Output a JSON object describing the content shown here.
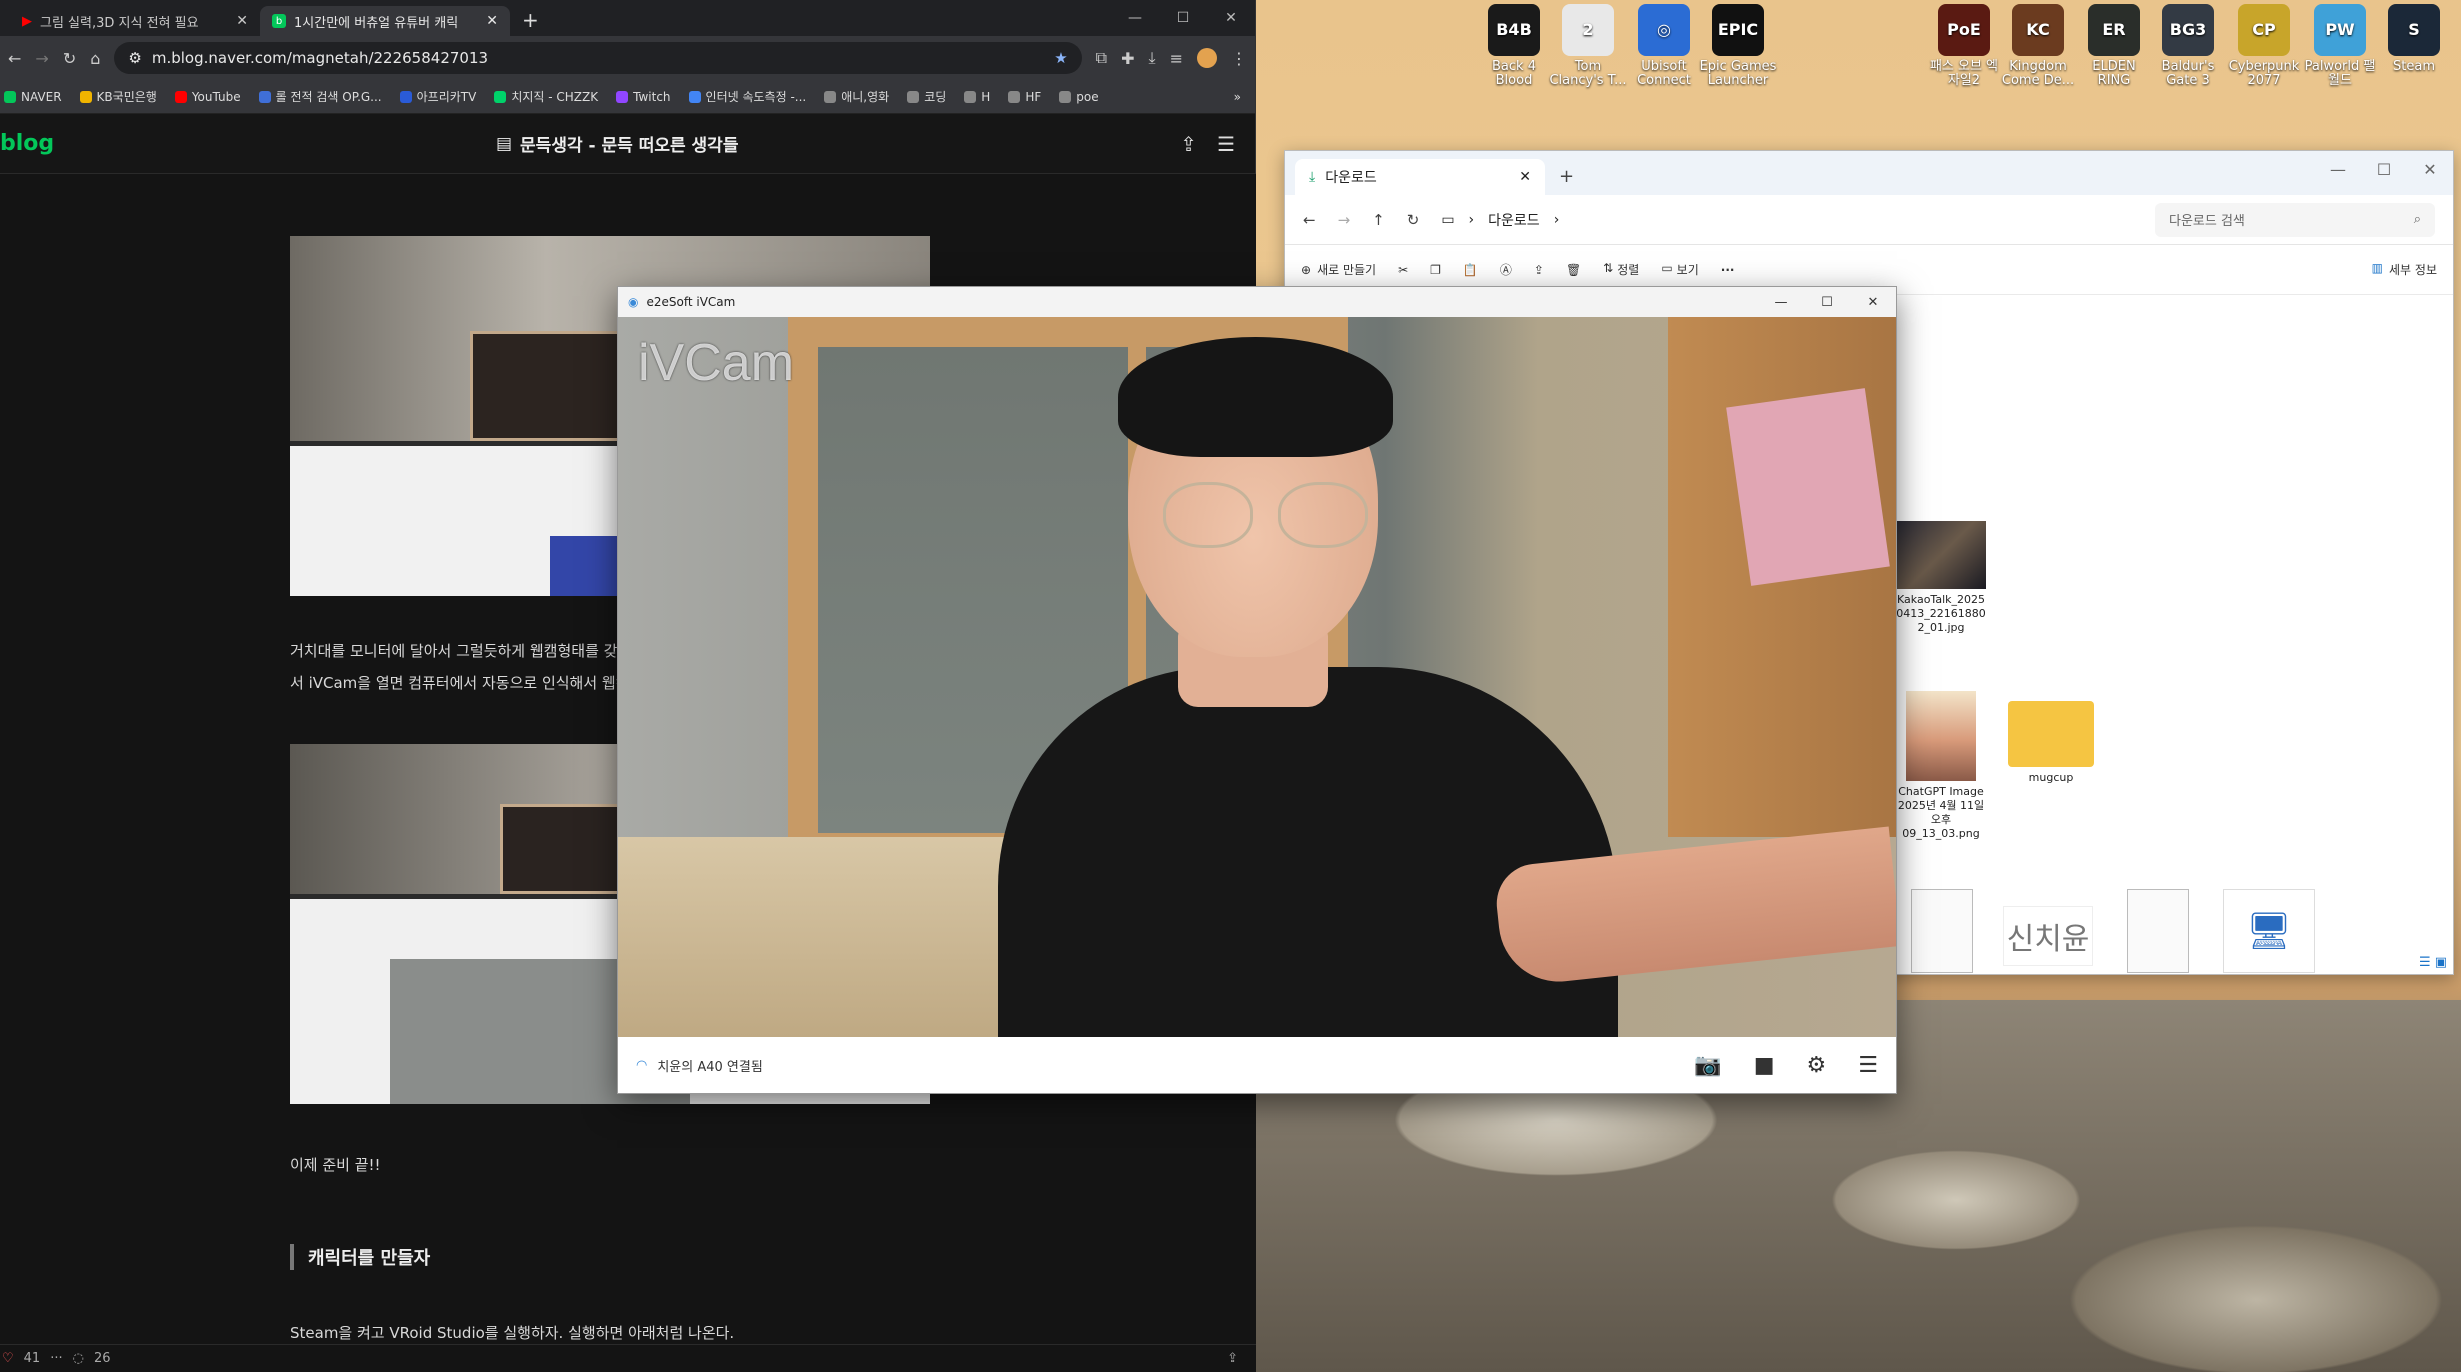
{
  "browser": {
    "tabs": [
      {
        "label": "그림 실력,3D 지식 전혀 필요",
        "close": "✕"
      },
      {
        "label": "1시간만에 버츄얼 유튜버 캐릭",
        "close": "✕"
      }
    ],
    "new_tab": "+",
    "url": "m.blog.naver.com/magnetah/222658427013",
    "bookmarks": [
      "NAVER",
      "KB국민은행",
      "YouTube",
      "롤 전적 검색 OP.G...",
      "아프리카TV",
      "치지직 - CHZZK",
      "Twitch",
      "인터넷 속도측정 -...",
      "애니,영화",
      "코딩",
      "H",
      "HF",
      "poe"
    ],
    "more": "»",
    "blog_logo": "blog",
    "blog_title": "문득생각 - 문득 떠오른 생각들",
    "paragraph1_line1": "거치대를 모니터에 달아서 그럴듯하게 웹캠형태를 갖춰",
    "paragraph1_line2": "서  iVCam을 열면 컴퓨터에서 자동으로 인식해서 웹캠",
    "ready_text": "이제 준비 끝!!",
    "section_heading": "캐릭터를 만들자",
    "steam_text": "Steam을 켜고 VRoid Studio를 실행하자. 실행하면 아래처럼 나온다.",
    "like_count": "41",
    "comment_count": "26",
    "dots": "···"
  },
  "desktop_icons": [
    {
      "label": "Back 4 Blood",
      "glyph": "B4B",
      "color": "#1a1a1a"
    },
    {
      "label": "Tom Clancy's T...",
      "glyph": "2",
      "color": "#e8e8e8"
    },
    {
      "label": "Ubisoft Connect",
      "glyph": "◎",
      "color": "#2b6cd4"
    },
    {
      "label": "Epic Games Launcher",
      "glyph": "EPIC",
      "color": "#111"
    },
    {
      "label": "패스 오브 엑자일2",
      "glyph": "PoE",
      "color": "#5a1a12"
    },
    {
      "label": "Kingdom Come De...",
      "glyph": "KC",
      "color": "#6b3b1f"
    },
    {
      "label": "ELDEN RING",
      "glyph": "ER",
      "color": "#2a2e2a"
    },
    {
      "label": "Baldur's Gate 3",
      "glyph": "BG3",
      "color": "#333a44"
    },
    {
      "label": "Cyberpunk 2077",
      "glyph": "CP",
      "color": "#c8a52a"
    },
    {
      "label": "Palworld 팰월드",
      "glyph": "PW",
      "color": "#3fa1d8"
    },
    {
      "label": "Steam",
      "glyph": "S",
      "color": "#1b2838"
    }
  ],
  "explorer": {
    "tab_label": "다운로드",
    "path": "다운로드",
    "search_placeholder": "다운로드 검색",
    "cmd_new": "새로 만들기",
    "cmd_sort": "정렬",
    "cmd_view": "보기",
    "cmd_more": "···",
    "cmd_details": "세부 정보",
    "files": [
      {
        "name": "KakaoTalk_20250413_221618802_01.jpg"
      },
      {
        "name": "ChatGPT Image 2025년 4월 11일 오후 09_13_03.png"
      },
      {
        "name": "mugcup"
      }
    ],
    "signature_text": "신치윤"
  },
  "ivcam": {
    "title": "e2eSoft iVCam",
    "watermark": "iVCam",
    "status": "치윤의 A40 연결됨"
  }
}
